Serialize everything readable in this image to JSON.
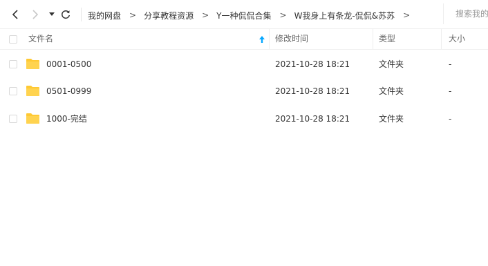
{
  "toolbar": {
    "back_icon": "chevron-left-icon",
    "forward_icon": "chevron-right-icon",
    "dropdown_icon": "caret-down-icon",
    "refresh_icon": "refresh-icon",
    "breadcrumb": [
      "我的网盘",
      "分享教程资源",
      "Y一种侃侃合集",
      "W我身上有条龙-侃侃&苏苏"
    ],
    "breadcrumb_separator": ">",
    "search_placeholder": "搜索我的"
  },
  "header": {
    "name": "文件名",
    "mtime": "修改时间",
    "type": "类型",
    "size": "大小",
    "sort_icon": "arrow-up-icon",
    "accent_color": "#06a7ff"
  },
  "rows": [
    {
      "name": "0001-0500",
      "mtime": "2021-10-28 18:21",
      "type": "文件夹",
      "size": "-"
    },
    {
      "name": "0501-0999",
      "mtime": "2021-10-28 18:21",
      "type": "文件夹",
      "size": "-"
    },
    {
      "name": "1000-完结",
      "mtime": "2021-10-28 18:21",
      "type": "文件夹",
      "size": "-"
    }
  ],
  "folder_color": "#ffc933"
}
